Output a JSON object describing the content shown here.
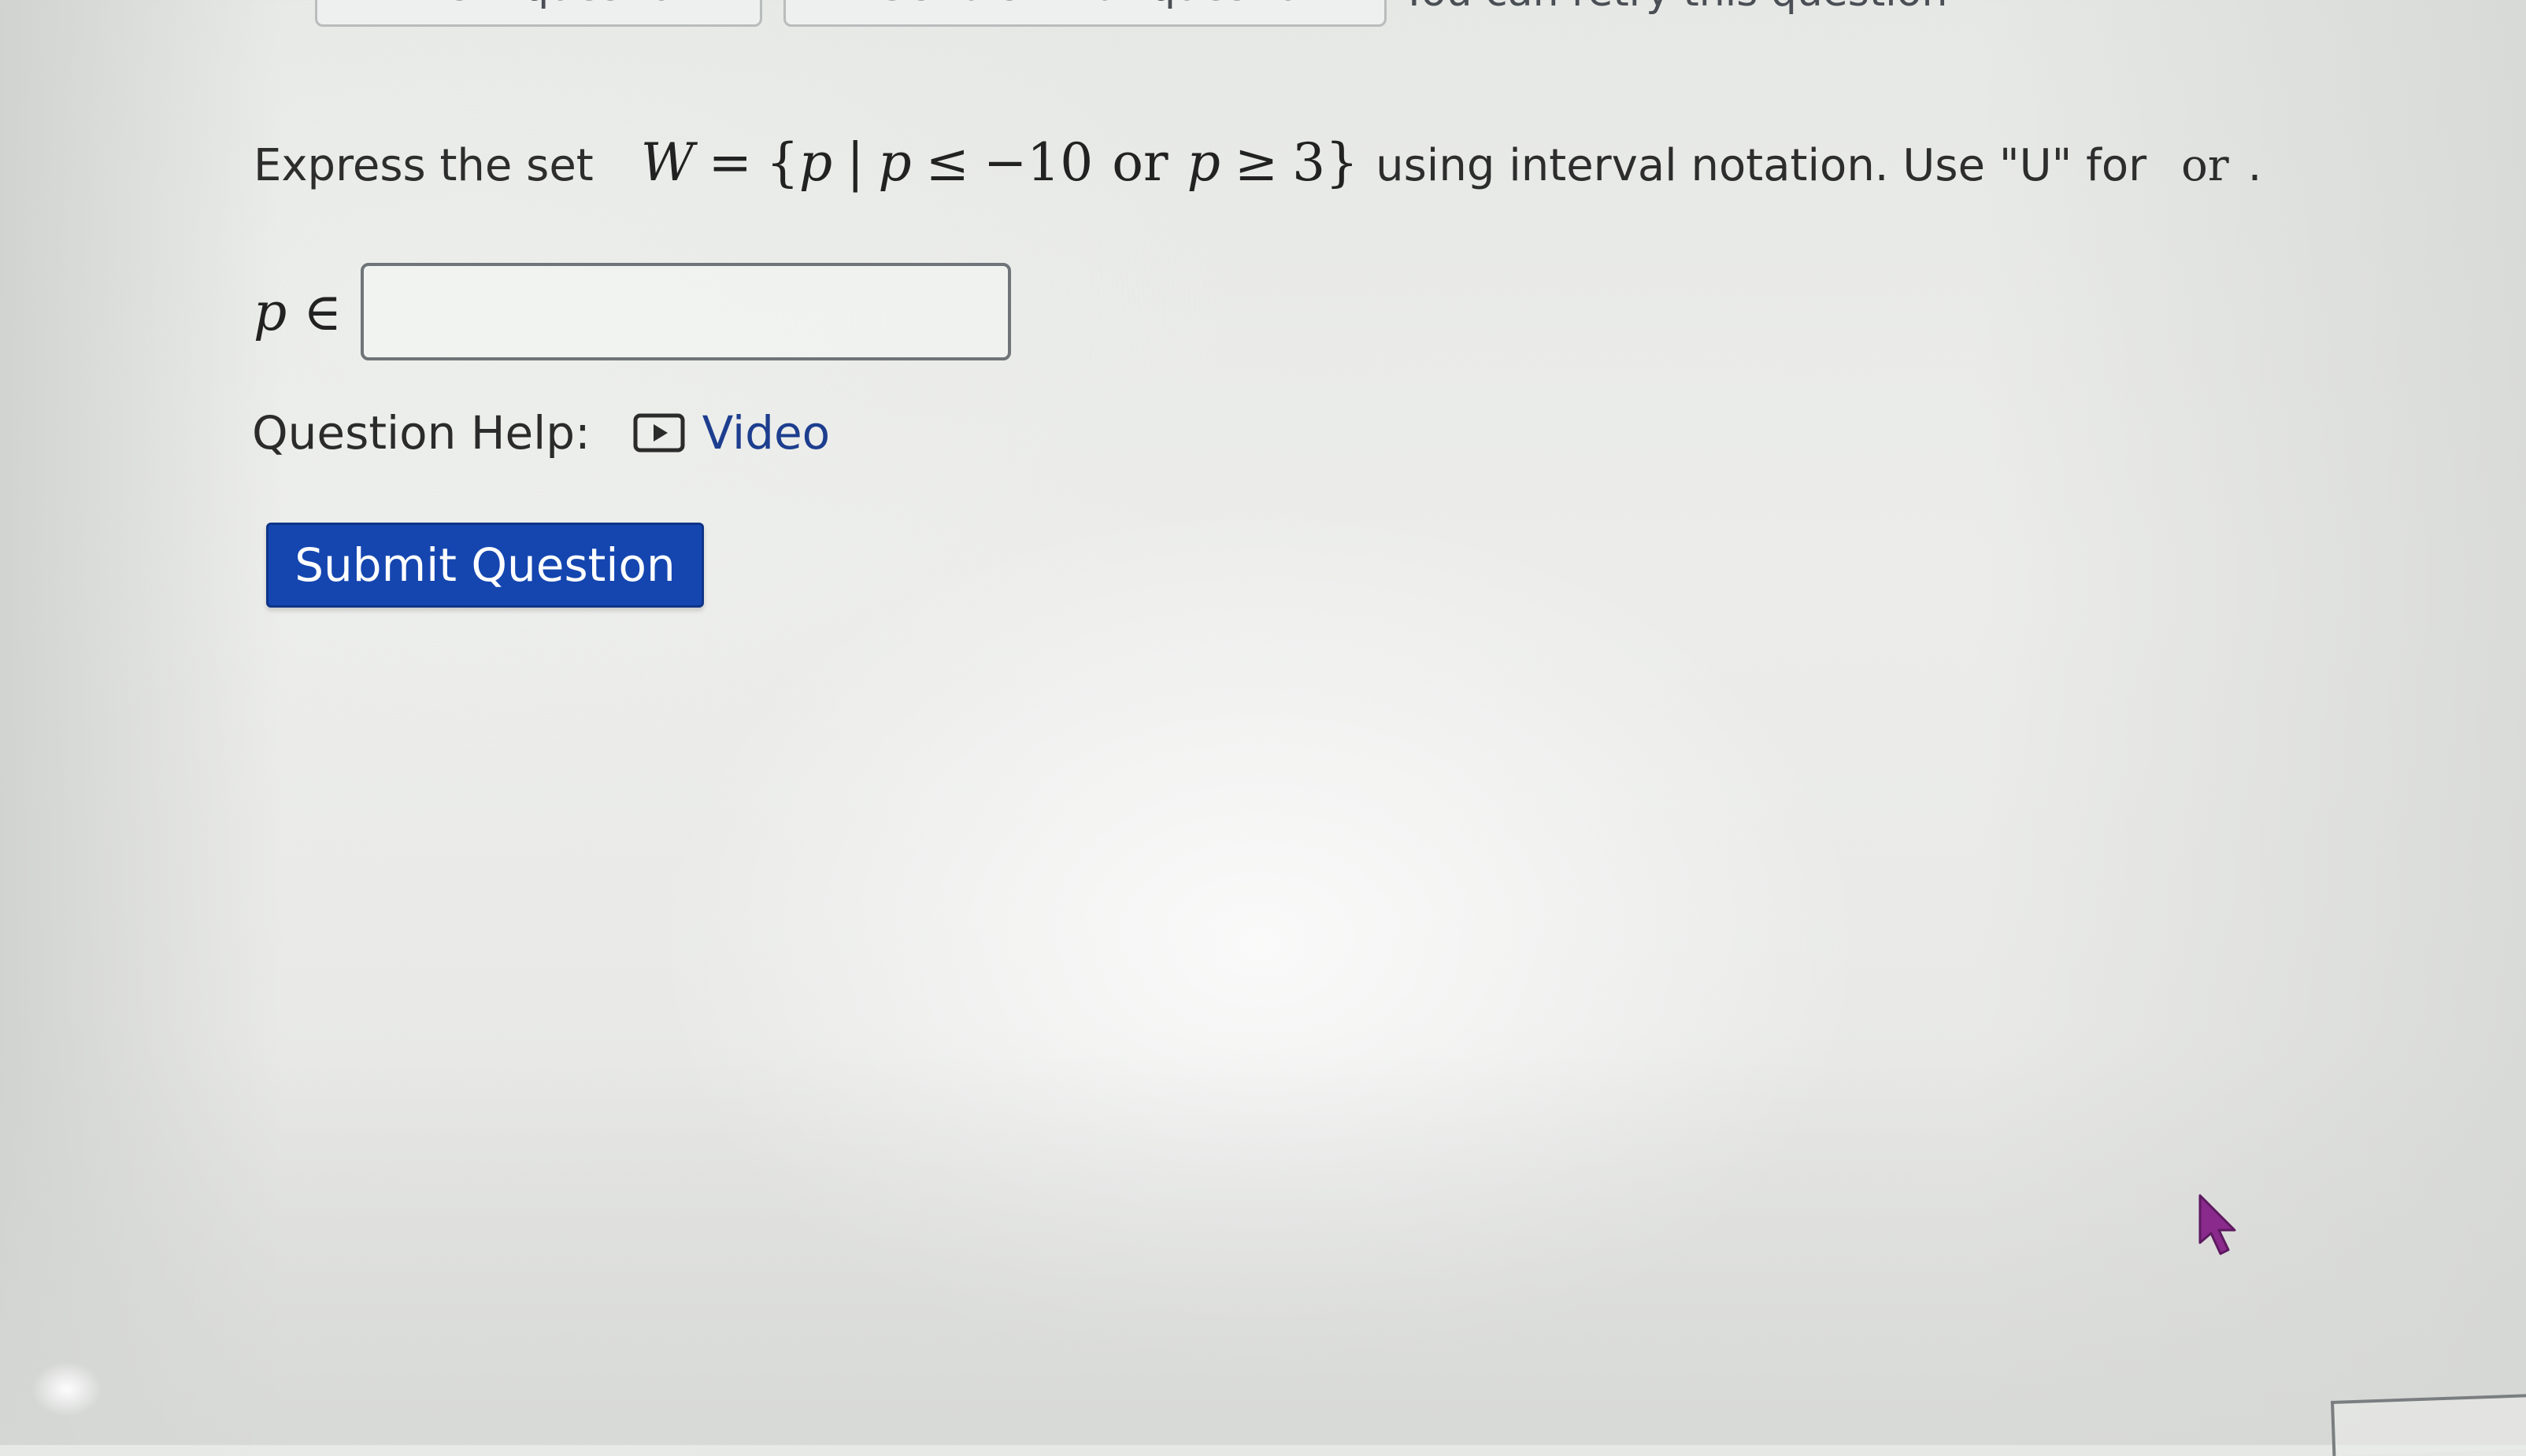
{
  "toolbar": {
    "next_question_label": "Next question",
    "similar_question_label": "Get a similar question",
    "extra_text": "You can retry this question"
  },
  "question": {
    "lead": "Express the set",
    "math": {
      "set_name": "W",
      "equals": "=",
      "open_brace": "{",
      "var": "p",
      "bar": "|",
      "var2": "p",
      "leq": "≤",
      "neg_ten": "−10",
      "or_word": "or",
      "var3": "p",
      "geq": "≥",
      "three": "3",
      "close_brace": "}"
    },
    "tail": "using interval notation. Use \"U\" for",
    "or_trail": "or",
    "period": "."
  },
  "answer": {
    "label_var": "p",
    "label_in": "∈",
    "value": "",
    "placeholder": ""
  },
  "help": {
    "label": "Question Help:",
    "video_label": "Video",
    "video_icon": "video-play-icon"
  },
  "submit": {
    "label": "Submit Question",
    "color": "#1546b0"
  },
  "cursor": {
    "icon": "mouse-pointer-icon",
    "color": "#8a2a8c"
  }
}
